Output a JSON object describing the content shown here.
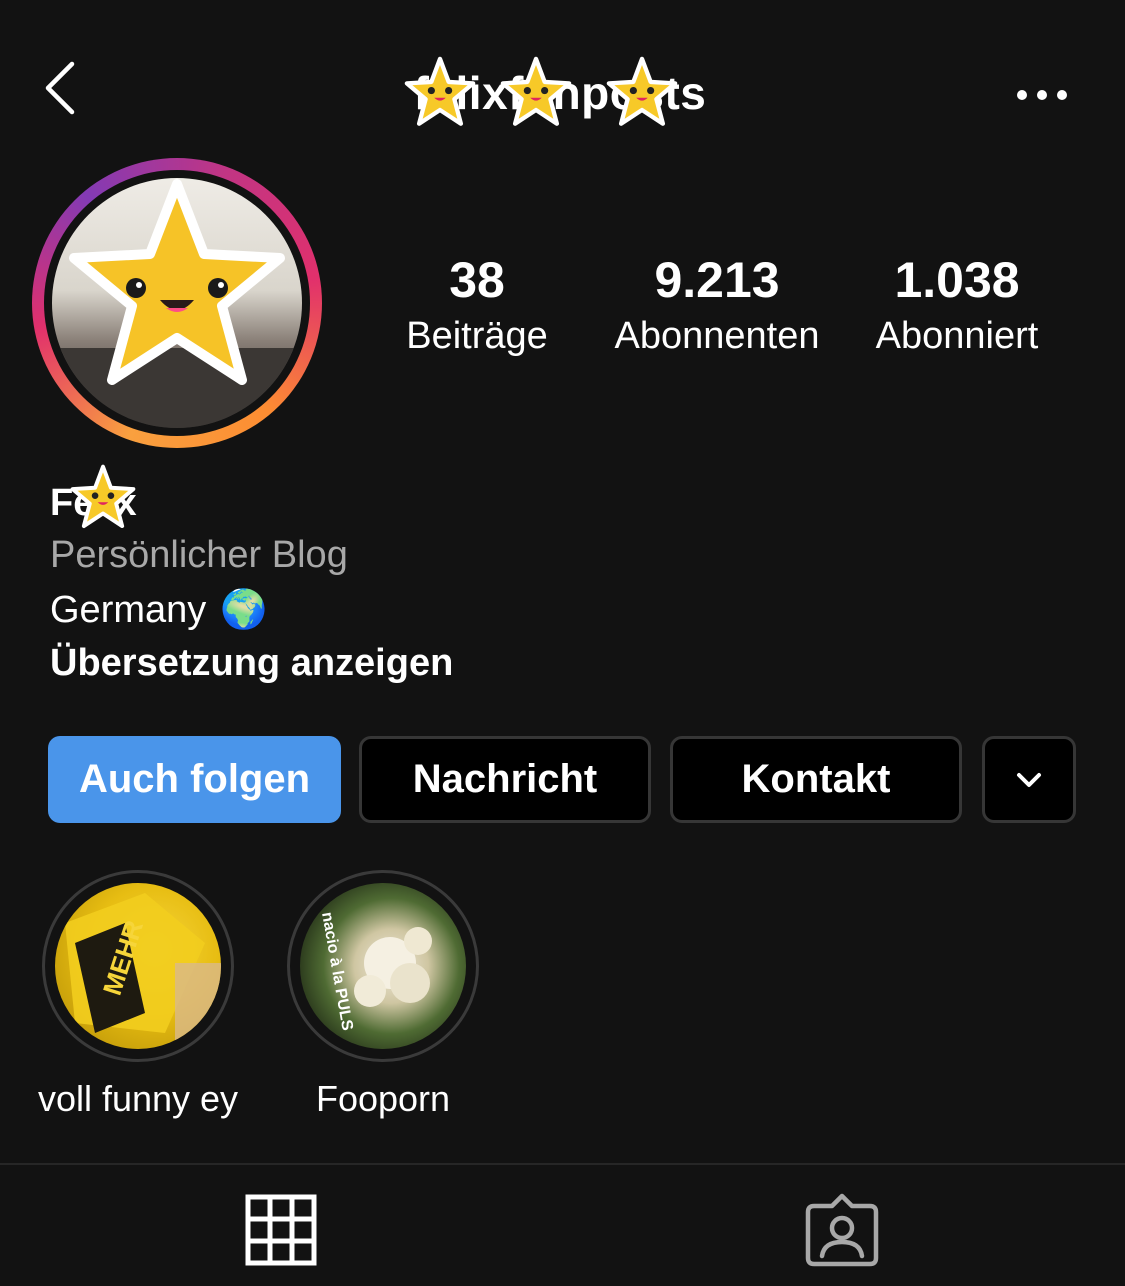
{
  "header": {
    "username": "felixfunposts"
  },
  "stats": [
    {
      "value": "38",
      "label": "Beiträge"
    },
    {
      "value": "9.213",
      "label": "Abonnenten"
    },
    {
      "value": "1.038",
      "label": "Abonniert"
    }
  ],
  "bio": {
    "name": "Felix",
    "category": "Persönlicher Blog",
    "location": "Germany",
    "location_emoji": "🌍",
    "translate_link": "Übersetzung anzeigen"
  },
  "actions": {
    "follow_back": "Auch folgen",
    "message": "Nachricht",
    "contact": "Kontakt"
  },
  "highlights": [
    {
      "label": "voll funny ey",
      "thumb_text": "MEHR"
    },
    {
      "label": "Fooporn",
      "thumb_text": "nacio à la PULS"
    }
  ],
  "colors": {
    "background": "#121212",
    "follow_button": "#4a95ea",
    "secondary_text": "#a8a8a8",
    "sticker_star": "#f7c928"
  },
  "icons": {
    "back": "chevron-left-icon",
    "more": "more-horizontal-icon",
    "dropdown": "chevron-down-icon",
    "grid_tab": "grid-icon",
    "tagged_tab": "tagged-person-icon"
  }
}
